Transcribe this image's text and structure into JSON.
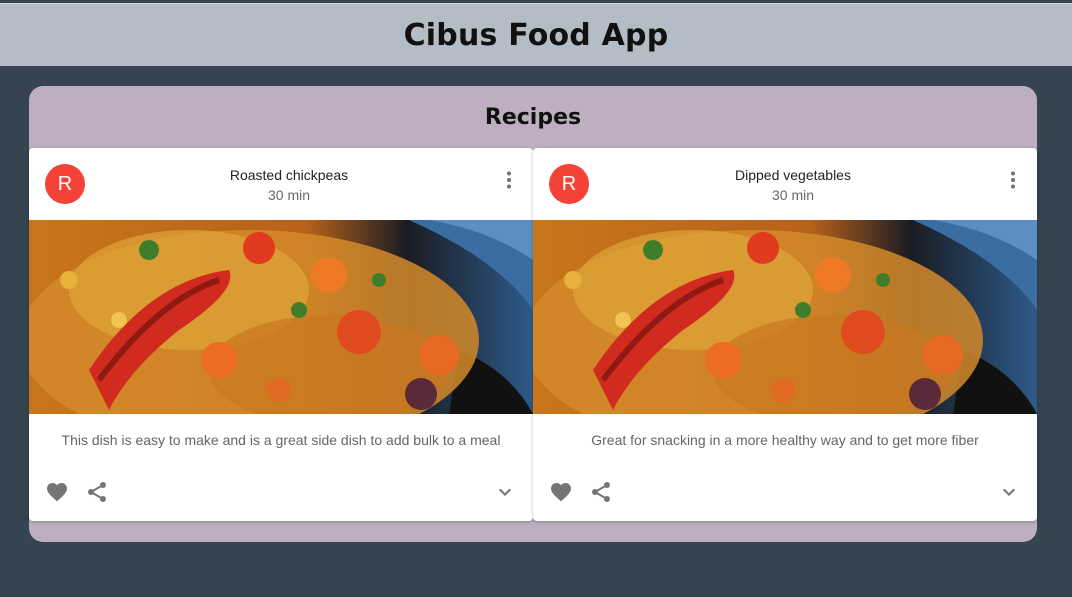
{
  "header": {
    "title": "Cibus Food App"
  },
  "panel": {
    "title": "Recipes"
  },
  "cards": [
    {
      "avatar": "R",
      "title": "Roasted chickpeas",
      "subheader": "30 min",
      "description": "This dish is easy to make and is a great side dish to add bulk to a meal"
    },
    {
      "avatar": "R",
      "title": "Dipped vegetables",
      "subheader": "30 min",
      "description": "Great for snacking in a more healthy way and to get more fiber"
    }
  ],
  "icons": {
    "more": "more-vert-icon",
    "favorite": "heart-icon",
    "share": "share-icon",
    "expand": "chevron-down-icon"
  },
  "colors": {
    "page_bg": "#364450",
    "header_bg": "#b4bcc5",
    "panel_bg": "#bdafc0",
    "avatar_bg": "#f44336",
    "icon_gray": "#757575"
  }
}
